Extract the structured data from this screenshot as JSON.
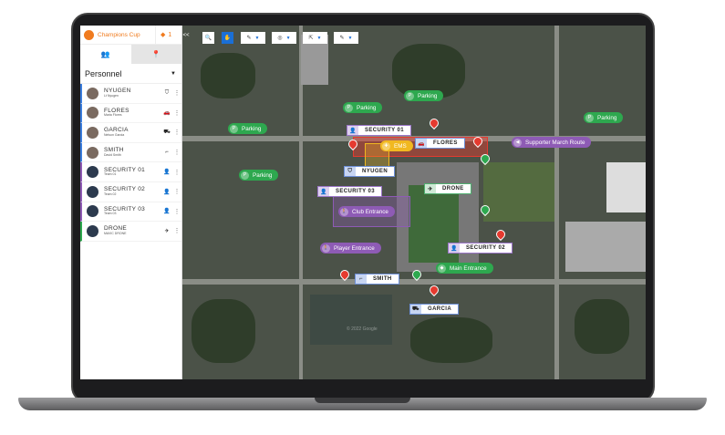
{
  "app": {
    "event": "Champions Cup",
    "layers_count": "1",
    "collapse": "<<"
  },
  "sidebar": {
    "tabs": [
      "people-icon",
      "location-pin-icon"
    ],
    "category": "Personnel",
    "people": [
      {
        "name": "NYUGEN",
        "sub": "Lt Nyugen",
        "icon": "police-badge-icon",
        "group": "blue"
      },
      {
        "name": "FLORES",
        "sub": "Maria Flores",
        "icon": "car-icon",
        "group": "blue"
      },
      {
        "name": "GARCIA",
        "sub": "Nelson Garcia",
        "icon": "motorcycle-icon",
        "group": "blue"
      },
      {
        "name": "SMITH",
        "sub": "David Smith",
        "icon": "gun-icon",
        "group": "blue"
      },
      {
        "name": "SECURITY 01",
        "sub": "Team 01",
        "icon": "person-icon",
        "group": "purple"
      },
      {
        "name": "SECURITY 02",
        "sub": "Team 02",
        "icon": "person-icon",
        "group": "purple"
      },
      {
        "name": "SECURITY 03",
        "sub": "Team 03",
        "icon": "person-icon",
        "group": "purple"
      },
      {
        "name": "DRONE",
        "sub": "MAVIC DRONE",
        "icon": "drone-icon",
        "group": "green"
      }
    ]
  },
  "toolbar": [
    "search-icon",
    "hand-icon",
    "pen-icon",
    "target-icon",
    "export-icon",
    "edit-icon"
  ],
  "map": {
    "units": {
      "security01": "SECURITY 01",
      "flores": "FLORES",
      "nyugen": "NYUGEN",
      "security03": "SECURITY 03",
      "drone": "DRONE",
      "security02": "SECURITY 02",
      "smith": "SMITH",
      "garcia": "GARCIA"
    },
    "places": {
      "parking": "Parking",
      "ems": "EMS",
      "supporter": "Supporter March Route",
      "club": "Club Entrance",
      "player": "Player Entrance",
      "main": "Main Entrance"
    },
    "watermark": "© 2022 Google"
  },
  "colors": {
    "accent": "#f07b1e",
    "blue": "#3b7ddd",
    "purple": "#8e5bb5",
    "green": "#2ea84f",
    "red": "#e53a2f",
    "yellow": "#f1b820"
  }
}
